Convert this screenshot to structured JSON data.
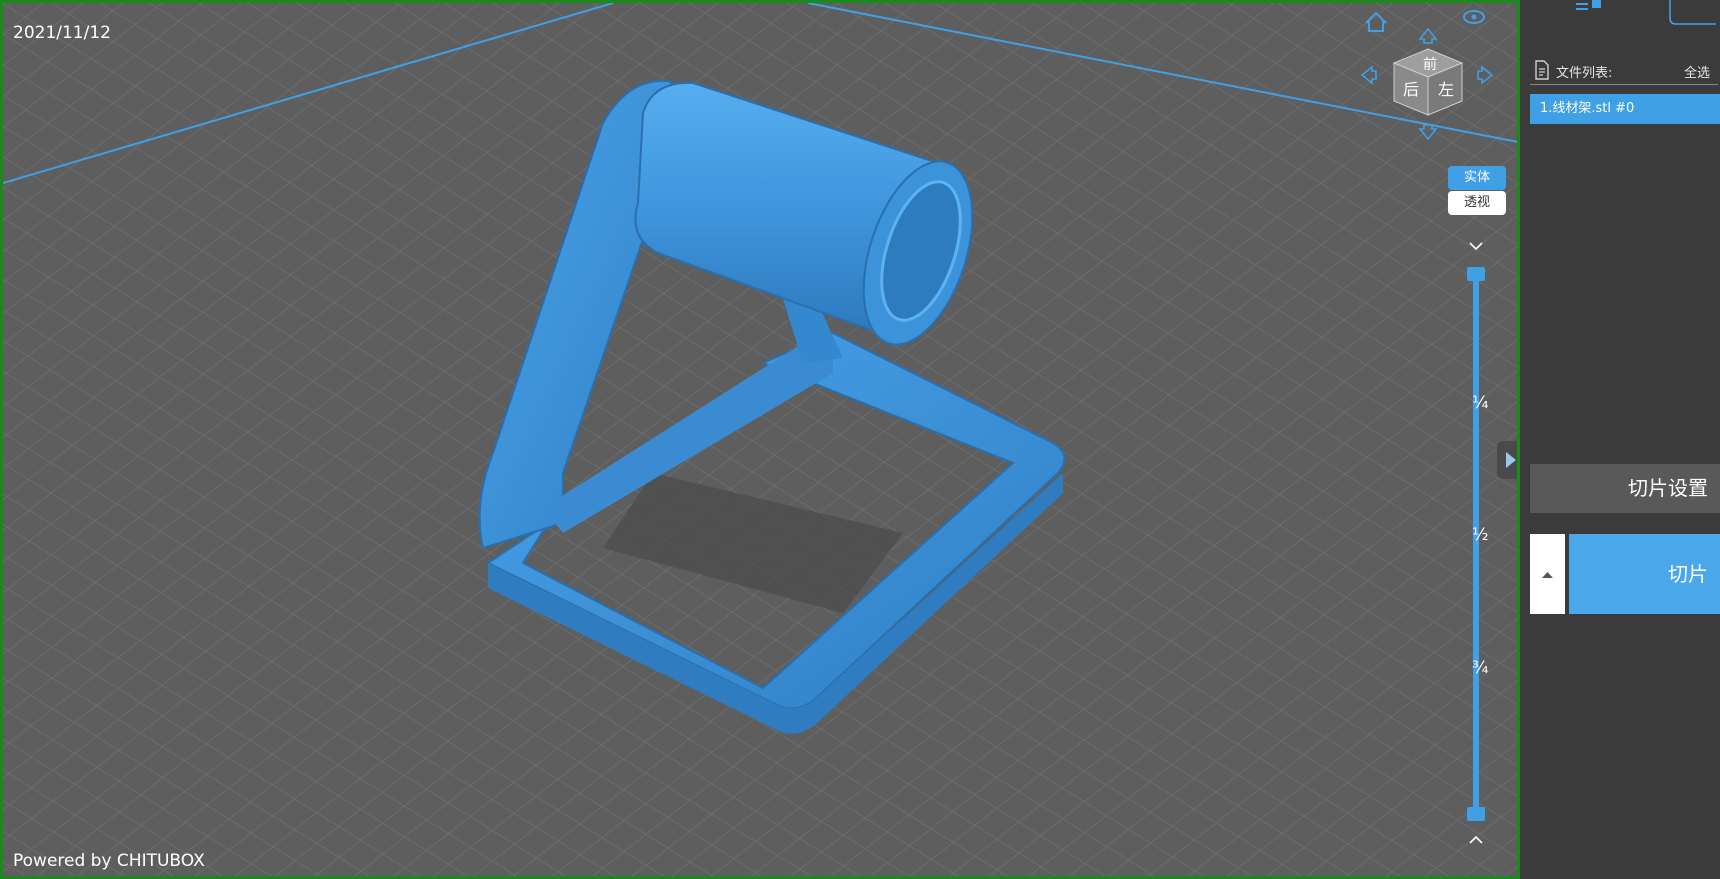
{
  "viewport": {
    "date": "2021/11/12",
    "powered_by": "Powered by CHITUBOX"
  },
  "nav_cube": {
    "face_top": "前",
    "face_front": "后",
    "face_right": "左"
  },
  "view_mode": {
    "solid_label": "实体",
    "xray_label": "透视",
    "active": "实体"
  },
  "layer_slider": {
    "tick_quarter": "¼",
    "tick_half": "½",
    "tick_three_quarter": "¾"
  },
  "sidebar": {
    "file_list_title": "文件列表:",
    "select_all_label": "全选",
    "files": [
      {
        "label": "1.线材架.stl #0"
      }
    ],
    "slice_settings_label": "切片设置",
    "slice_label": "切片"
  },
  "colors": {
    "accent": "#3fa0e6",
    "model": "#3d8ed6",
    "grid_bg": "#5e5e5e",
    "sidebar_bg": "#3b3b3b"
  }
}
